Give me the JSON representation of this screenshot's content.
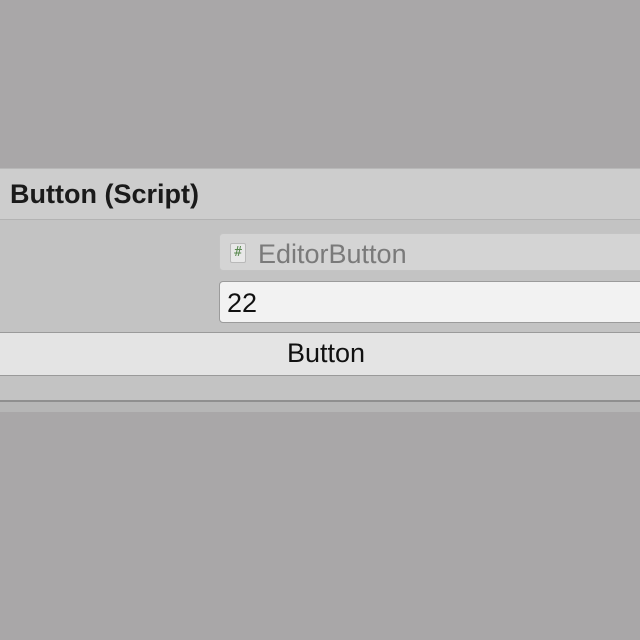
{
  "component": {
    "title": "Button (Script)"
  },
  "script_field": {
    "icon": "csharp-script-icon",
    "icon_glyph": "#",
    "value": "EditorButton"
  },
  "int_field": {
    "value": "22"
  },
  "action_button": {
    "label": "Button"
  },
  "colors": {
    "background": "#a9a7a8",
    "panel": "#c3c3c3",
    "header": "#cdcdcd",
    "button": "#e4e4e4"
  }
}
